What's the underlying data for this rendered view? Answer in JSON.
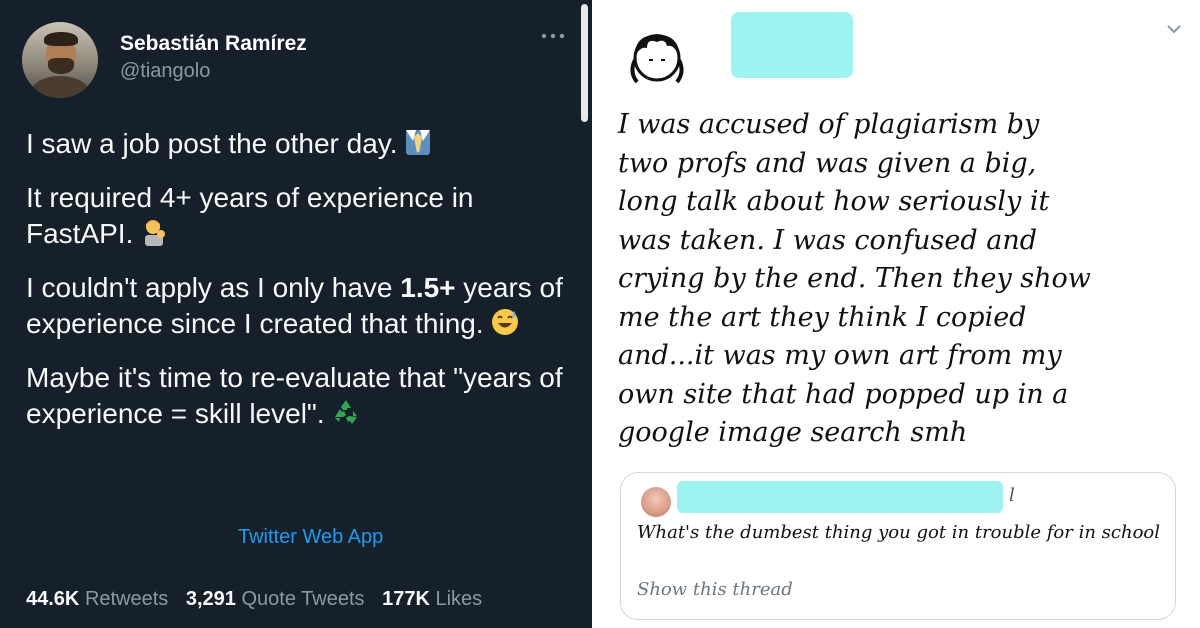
{
  "left_tweet": {
    "author_name": "Sebastián Ramírez",
    "author_handle": "@tiangolo",
    "paragraphs": {
      "p1": "I saw a job post the other day.",
      "p2": "It required 4+ years of experience in FastAPI.",
      "p3_before": "I couldn't apply as I only have ",
      "p3_bold": "1.5+",
      "p3_after": " years of experience since I created that thing.",
      "p4": "Maybe it's time to re-evaluate that \"years of experience = skill level\"."
    },
    "emojis": [
      "necktie-emoji",
      "person-tipping-hand-emoji",
      "grinning-sweat-emoji",
      "recycling-symbol-emoji"
    ],
    "source": "Twitter Web App",
    "stats": {
      "retweets_count": "44.6K",
      "retweets_label": "Retweets",
      "quotes_count": "3,291",
      "quotes_label": "Quote Tweets",
      "likes_count": "177K",
      "likes_label": "Likes"
    },
    "colors": {
      "background": "#15202b",
      "link": "#1d9bf0",
      "muted": "#8b98a5"
    }
  },
  "right_tweet": {
    "text": "I was accused of plagiarism by\ntwo profs and was given a big,\nlong talk about how seriously it\nwas taken. I was confused and\ncrying by the end. Then they show\nme the art they think I copied\nand...it was my own art from my\nown site that had popped up in a\ngoogle image search smh",
    "quoted": {
      "name_suffix": "l",
      "text": "What's the dumbest thing you got in trouble for in school",
      "link": "Show this thread"
    },
    "colors": {
      "redaction": "#9df3f0"
    }
  }
}
